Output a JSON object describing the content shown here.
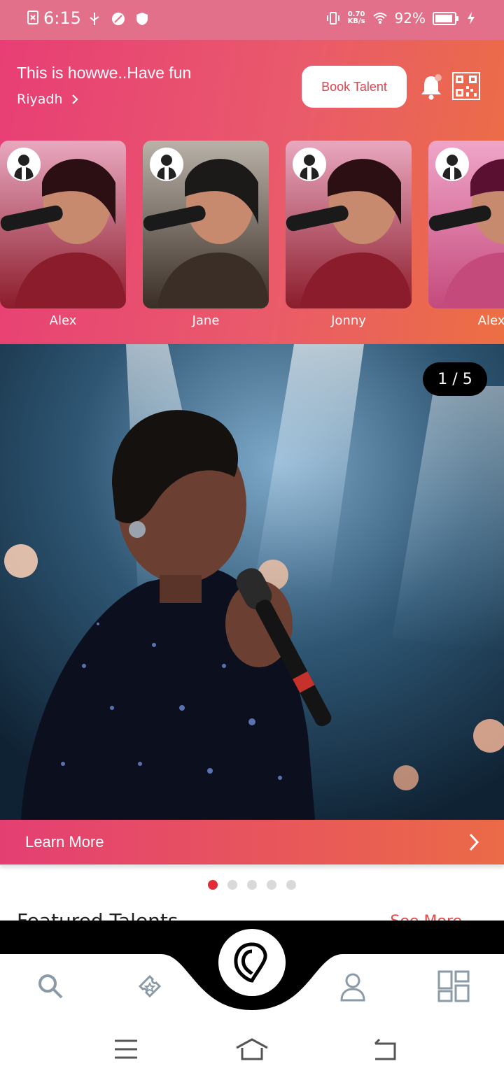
{
  "status_bar": {
    "time": "6:15",
    "speed_value": "0.70",
    "speed_unit": "KB/s",
    "battery": "92%",
    "battery_level": 0.92,
    "icons": [
      "sim-off-icon",
      "usb-icon",
      "leaf-icon",
      "shield-icon",
      "vibrate-icon",
      "wifi-icon",
      "battery-icon",
      "charging-icon"
    ]
  },
  "header": {
    "title": "This is howwe..Have fun",
    "location": "Riyadh",
    "book_button": "Book Talent",
    "icons": [
      "bell-icon",
      "qr-code-icon"
    ],
    "accent": "#e83e75"
  },
  "stories": [
    {
      "name": "Alex"
    },
    {
      "name": "Jane"
    },
    {
      "name": "Jonny"
    },
    {
      "name": "Alex"
    }
  ],
  "banner": {
    "counter": "1 / 5",
    "learn_more": "Learn More",
    "slides": 5,
    "active_slide": 1
  },
  "section": {
    "title": "Featured Talents",
    "see_more": "See More"
  },
  "bottom_nav": {
    "items": [
      "search-icon",
      "ticket-icon",
      "app-logo-icon",
      "profile-icon",
      "dashboard-icon"
    ]
  },
  "system_nav": {
    "items": [
      "menu-icon",
      "home-icon",
      "back-icon"
    ]
  }
}
